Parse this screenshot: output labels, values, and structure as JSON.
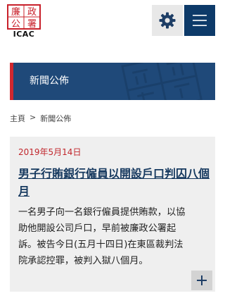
{
  "header": {
    "logo_text": "ICAC",
    "logo_chars": [
      "廉",
      "政",
      "公",
      "署"
    ],
    "settings_icon": "gear-icon",
    "menu_icon": "hamburger-icon"
  },
  "banner": {
    "title": "新聞公佈"
  },
  "breadcrumb": {
    "home": "主頁",
    "separator": ">",
    "current": "新聞公佈"
  },
  "article": {
    "date": "2019年5月14日",
    "title": "男子行賄銀行僱員以開設戶口判囚八個月",
    "body_lines": [
      "一名男子向一名銀行僱員提供賄款，以協",
      "助他開設公司戶口，早前被廉政公署起",
      "訴。被告今日(五月十四日)在東區裁判法",
      "院承認控罪，被判入獄八個月。"
    ],
    "expand_icon": "plus-icon"
  },
  "colors": {
    "navy": "#0d3a69",
    "banner": "#1f4979",
    "accent_red": "#c1272d"
  }
}
